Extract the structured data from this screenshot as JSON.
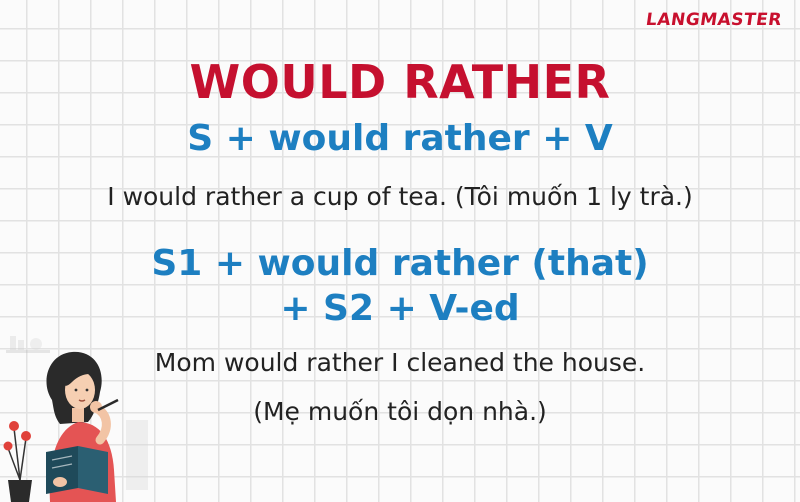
{
  "brand": {
    "logo": "LANGMASTER",
    "accent": "#c5102f",
    "formula_color": "#1d7fc1"
  },
  "title": "WOULD RATHER",
  "formula_1": "S + would rather + V",
  "example_1": "I would rather a cup of tea. (Tôi muốn 1 ly trà.)",
  "formula_2_line1": "S1 + would rather (that)",
  "formula_2_line2": "+ S2 + V-ed",
  "example_2": "Mom would rather I cleaned the house.",
  "example_2_translation": "(Mẹ muốn tôi dọn nhà.)",
  "illustration": {
    "icon": "woman-reading-book-illustration"
  }
}
